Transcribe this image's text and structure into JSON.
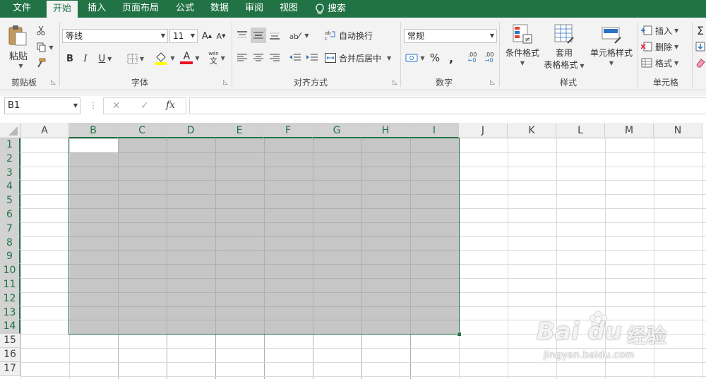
{
  "tabs": [
    "文件",
    "开始",
    "插入",
    "页面布局",
    "公式",
    "数据",
    "审阅",
    "视图"
  ],
  "search_label": "搜索",
  "active_tab": "开始",
  "clipboard": {
    "paste": "粘贴",
    "group": "剪贴板"
  },
  "font": {
    "name": "等线",
    "size": "11",
    "bold": "B",
    "italic": "I",
    "underline": "U",
    "font_color_glyph": "A",
    "grow_glyph": "A",
    "shrink_glyph": "A",
    "phonetic": "wén",
    "phonetic_char": "文",
    "group": "字体"
  },
  "alignment": {
    "wrap": "自动换行",
    "merge": "合并后居中",
    "group": "对齐方式"
  },
  "number": {
    "format": "常规",
    "percent": "%",
    "comma": ",",
    "inc_decimal": ".00",
    "dec_decimal": ".00",
    "group": "数字"
  },
  "styles": {
    "conditional": "条件格式",
    "table_line1": "套用",
    "table_line2": "表格格式",
    "cell_styles": "单元格样式",
    "group": "样式"
  },
  "cells": {
    "insert": "插入",
    "delete": "删除",
    "format": "格式",
    "group": "单元格"
  },
  "formula_bar": {
    "name_box": "B1",
    "fx": "fx",
    "cancel": "✕",
    "enter": "✓",
    "content": ""
  },
  "grid": {
    "columns": [
      "A",
      "B",
      "C",
      "D",
      "E",
      "F",
      "G",
      "H",
      "I",
      "J",
      "K",
      "L",
      "M",
      "N"
    ],
    "rows": [
      "1",
      "2",
      "3",
      "4",
      "5",
      "6",
      "7",
      "8",
      "9",
      "10",
      "11",
      "12",
      "13",
      "14",
      "15",
      "16",
      "17"
    ],
    "selection": "B1:I14",
    "active_cell": "B1"
  },
  "watermark": {
    "brand": "Bai du",
    "brand_cn": "经验",
    "url": "jingyan.baidu.com"
  },
  "colors": {
    "accent": "#217346",
    "selection": "#c6c6c6",
    "font_red": "#e81123",
    "fill_yellow": "#ffff00"
  }
}
